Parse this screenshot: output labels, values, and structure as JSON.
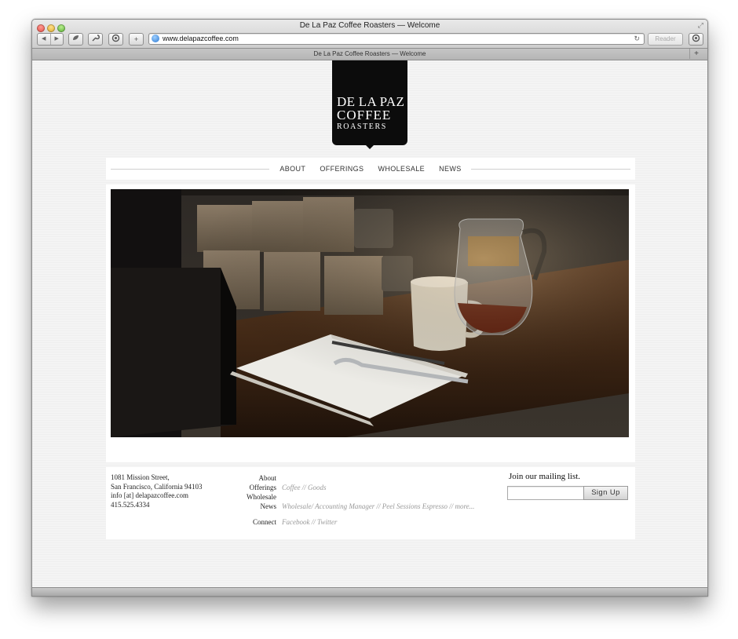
{
  "browser": {
    "window_title": "De La Paz Coffee Roasters — Welcome",
    "url": "www.delapazcoffee.com",
    "reader_label": "Reader",
    "tab_title": "De La Paz Coffee Roasters — Welcome",
    "back_glyph": "◀",
    "forward_glyph": "▶",
    "add_glyph": "+",
    "reload_glyph": "↻",
    "new_tab_glyph": "+",
    "fullscreen_glyph": "⤢",
    "icons": [
      "back-icon",
      "forward-icon",
      "sidebar-icon",
      "tools-icon",
      "page-icon",
      "add-bookmark-icon",
      "globe-icon",
      "reload-icon",
      "download-icon",
      "new-tab-icon",
      "fullscreen-icon"
    ]
  },
  "site": {
    "logo": {
      "line1": "DE LA PAZ",
      "line2": "COFFEE",
      "line3": "ROASTERS"
    },
    "nav": [
      "ABOUT",
      "OFFERINGS",
      "WHOLESALE",
      "NEWS"
    ],
    "hero_image": "photo: open notebook with pen and spoon, white coffee mug and glass coffee pot on wooden counter, bags of coffee in background",
    "footer": {
      "address": [
        "1081 Mission Street,",
        "San Francisco, California 94103",
        "info [at] delapazcoffee.com",
        "415.525.4334"
      ],
      "nav": {
        "about": "About",
        "offerings": "Offerings",
        "wholesale": "Wholesale",
        "news": "News",
        "connect": "Connect"
      },
      "sub": {
        "offerings": "Coffee // Goods",
        "news": "Wholesale/ Accounting Manager // Peel Sessions Espresso // more...",
        "connect": "Facebook // Twitter"
      },
      "mailing_heading": "Join our mailing list.",
      "mailing_placeholder": "",
      "signup_label": "Sign Up"
    }
  }
}
